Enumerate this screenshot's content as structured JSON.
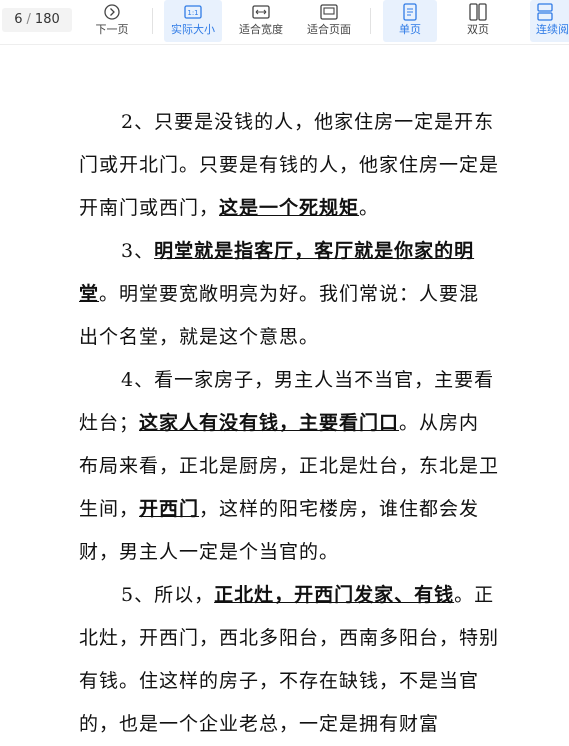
{
  "toolbar": {
    "page_current": "6",
    "page_sep": "/",
    "page_total": "180",
    "buttons": [
      {
        "label": "下一页",
        "icon": "next-page-icon"
      },
      {
        "label": "实际大小",
        "icon": "actual-size-icon"
      },
      {
        "label": "适合宽度",
        "icon": "fit-width-icon"
      },
      {
        "label": "适合页面",
        "icon": "fit-page-icon"
      },
      {
        "label": "单页",
        "icon": "single-page-icon"
      },
      {
        "label": "双页",
        "icon": "double-page-icon"
      },
      {
        "label": "连续阅",
        "icon": "continuous-read-icon"
      }
    ],
    "accent_color": "#2f7be6"
  },
  "document": {
    "p1_a": "2、只要是没钱的人，他家住房一定是开东门或开北门。只要是有钱的人，他家住房一定是开南门或西门，",
    "p1_u": "这是一个死规矩",
    "p1_b": "。",
    "p2_a": "3、",
    "p2_u": "明堂就是指客厅，客厅就是你家的明堂",
    "p2_b": "。明堂要宽敞明亮为好。我们常说：人要混出个名堂，就是这个意思。",
    "p3_a": "4、看一家房子，男主人当不当官，主要看灶台；",
    "p3_u1": "这家人有没有钱，主要看门口",
    "p3_b": "。从房内布局来看，正北是厨房，正北是灶台，东北是卫生间，",
    "p3_u2": "开西门",
    "p3_c": "，这样的阳宅楼房，谁住都会发财，男主人一定是个当官的。",
    "p4_a": "5、所以，",
    "p4_u": "正北灶，开西门发家、有钱",
    "p4_b": "。正北灶，开西门，西北多阳台，西南多阳台，特别有钱。住这样的房子，不存在缺钱，不是当官的，也是一个企业老总，一定是拥有财富"
  }
}
